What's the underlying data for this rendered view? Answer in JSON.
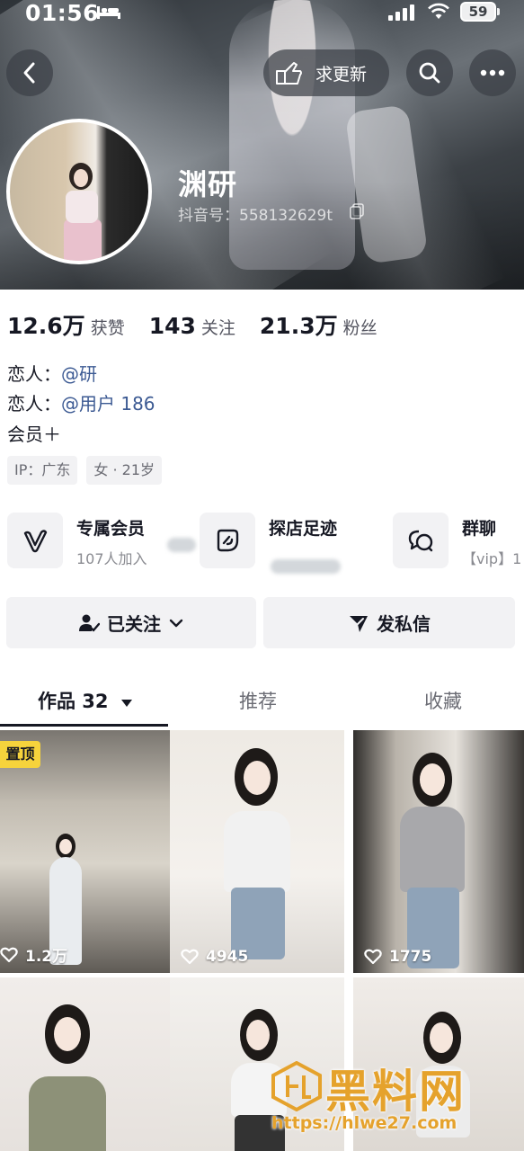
{
  "status_bar": {
    "time": "01:56",
    "battery": "59"
  },
  "header": {
    "update_label": "求更新",
    "nickname": "渊研",
    "douyin_id": "抖音号：558132629t"
  },
  "stats": [
    {
      "value": "12.6万",
      "label": "获赞"
    },
    {
      "value": "143",
      "label": "关注"
    },
    {
      "value": "21.3万",
      "label": "粉丝"
    }
  ],
  "bio": {
    "line1_prefix": "恋人：",
    "line1_mention": "@研",
    "line2_prefix": "恋人：",
    "line2_mention": "@用户 186",
    "line3": "会员＋"
  },
  "tags": [
    "IP：广东",
    "女 · 21岁"
  ],
  "features": [
    {
      "title": "专属会员",
      "subtitle": "107人加入",
      "icon": "v-badge-icon"
    },
    {
      "title": "探店足迹",
      "subtitle": "",
      "icon": "location-tag-icon"
    },
    {
      "title": "群聊",
      "subtitle": "【vip】1",
      "icon": "chat-bubble-icon"
    }
  ],
  "actions": {
    "follow_label": "已关注",
    "message_label": "发私信"
  },
  "tabs": [
    {
      "label": "作品 32",
      "active": true
    },
    {
      "label": "推荐",
      "active": false
    },
    {
      "label": "收藏",
      "active": false
    }
  ],
  "videos": [
    {
      "likes": "1.2万",
      "pinned": true,
      "pin_label": "置顶"
    },
    {
      "likes": "4945",
      "pinned": false
    },
    {
      "likes": "1775",
      "pinned": false
    },
    {
      "likes": "",
      "pinned": false
    },
    {
      "likes": "",
      "pinned": false
    },
    {
      "likes": "",
      "pinned": false
    }
  ],
  "watermark": {
    "title": "黑料网",
    "url": "https://hlwe27.com"
  },
  "colors": {
    "mention": "#3c5a93",
    "pin_badge": "#f6d33c",
    "watermark": "#e5a22c"
  }
}
